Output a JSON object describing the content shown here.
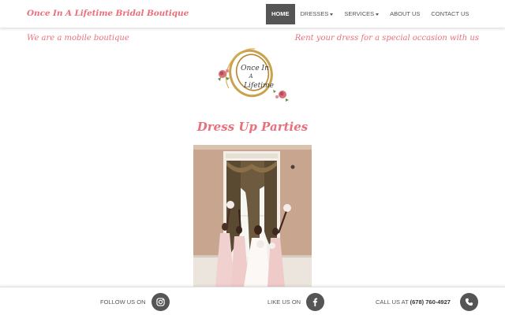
{
  "navbar": {
    "brand": "Once In A Lifetime Bridal Boutique",
    "items": [
      {
        "label": "HOME",
        "active": true,
        "dropdown": false
      },
      {
        "label": "DRESSES",
        "active": false,
        "dropdown": true
      },
      {
        "label": "SERVICES",
        "active": false,
        "dropdown": true
      },
      {
        "label": "ABOUT US",
        "active": false,
        "dropdown": false
      },
      {
        "label": "CONTACT US",
        "active": false,
        "dropdown": false
      }
    ]
  },
  "taglines": {
    "left": "We are a mobile boutique",
    "right": "Rent your dress for a special occasion with us"
  },
  "logo": {
    "line1": "Once In",
    "line2": "A",
    "line3": "Lifetime"
  },
  "main": {
    "heading": "Dress Up Parties"
  },
  "footer": {
    "follow_label": "FOLLOW US ON",
    "like_label": "LIKE US ON",
    "call_prefix": "CALL US AT",
    "phone": "(678) 760-4927"
  },
  "colors": {
    "accent": "#e8707a",
    "nav_active_bg": "#555555",
    "icon_circle": "#555555",
    "logo_gold": "#c9a24a"
  },
  "icons": {
    "instagram": "instagram-icon",
    "facebook": "facebook-icon",
    "phone": "phone-icon",
    "caret": "caret-down-icon"
  }
}
